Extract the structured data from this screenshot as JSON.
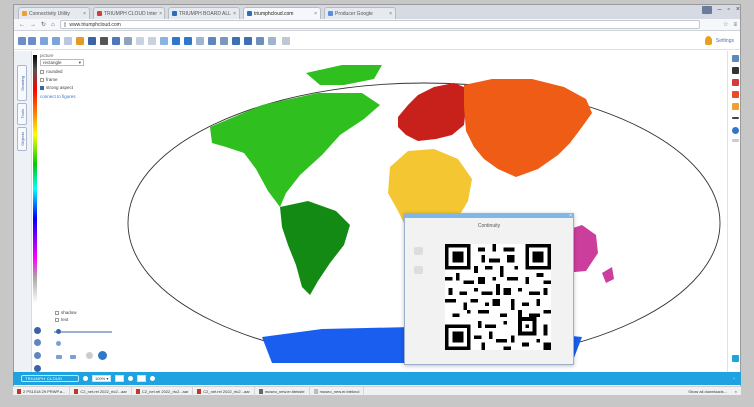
{
  "browser": {
    "tabs": [
      {
        "label": "Connectivity Utility",
        "color": "#f0a030"
      },
      {
        "label": "TRIUMPH CLOUD Inter",
        "color": "#d23c3c"
      },
      {
        "label": "TRIUMPH BOARD ALL",
        "color": "#2c6fb8"
      },
      {
        "label": "triumphcloud.com",
        "color": "#2c6fb8",
        "active": true
      },
      {
        "label": "Producer Google",
        "color": "#5a8de0"
      }
    ],
    "url": "www.triumphcloud.com"
  },
  "toolbar": {
    "settings_label": "Settings"
  },
  "sidebar": {
    "tabs": [
      "Drawing",
      "Tools",
      "Objects"
    ],
    "shape_title": "picture",
    "shape_value": "rectangle",
    "options": [
      {
        "label": "rounded",
        "checked": false
      },
      {
        "label": "frame",
        "checked": false
      },
      {
        "label": "strong aspect",
        "checked": true
      }
    ],
    "connect_label": "connect to figures",
    "bottom_options": [
      {
        "label": "shadow",
        "checked": false
      },
      {
        "label": "text",
        "checked": false
      }
    ]
  },
  "map": {
    "regions": [
      {
        "name": "north-america",
        "color": "#2fbf1f"
      },
      {
        "name": "south-america",
        "color": "#138a13"
      },
      {
        "name": "europe",
        "color": "#c8201a"
      },
      {
        "name": "asia",
        "color": "#ef5c16"
      },
      {
        "name": "africa",
        "color": "#f4c631"
      },
      {
        "name": "oceania",
        "color": "#cc3e9c"
      },
      {
        "name": "antarctica",
        "color": "#1a5ef0"
      }
    ]
  },
  "dialog": {
    "title": "Continuity"
  },
  "taskbar": {
    "brand": "TRIUMPH CLOUD",
    "zoom": "100%"
  },
  "downloads": {
    "items": [
      {
        "label": "2 PS1018 29 PRWP.a...",
        "type": "pdf"
      },
      {
        "label": "C2_net.rel 2022_rtc2...aar",
        "type": "pdf"
      },
      {
        "label": "C2_net.rel 2022_rtc2...aar",
        "type": "pdf"
      },
      {
        "label": "C2_net.rel 2022_rtc2...aar",
        "type": "pdf"
      },
      {
        "label": "museo_new.er.btekste",
        "type": "doc"
      },
      {
        "label": "museo_new.er.bteknol",
        "type": "gen"
      }
    ],
    "show_all": "Show all downloads..."
  },
  "colors": {
    "accent": "#1fa3e0",
    "link": "#3b74c8"
  }
}
